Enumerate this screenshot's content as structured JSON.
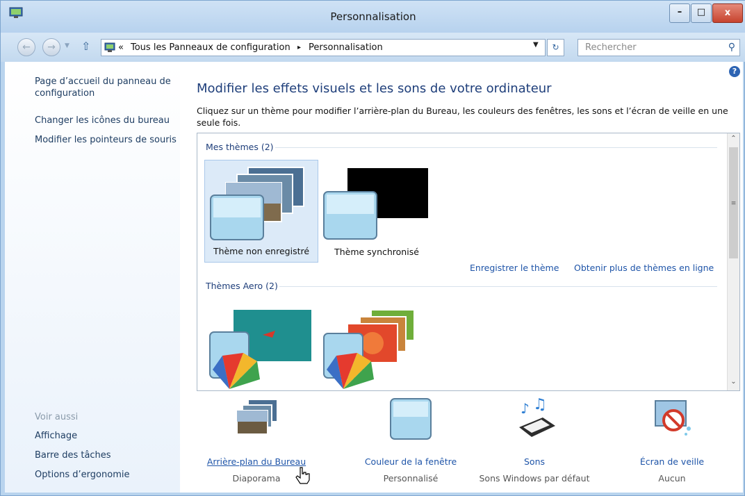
{
  "window": {
    "title": "Personnalisation"
  },
  "titlebar": {
    "minimize": "–",
    "maximize": "□",
    "close": "x"
  },
  "navbar": {
    "breadcrumb_sep": "«",
    "crumb1": "Tous les Panneaux de configuration",
    "crumb_arrow": "▸",
    "crumb2": "Personnalisation",
    "search_placeholder": "Rechercher"
  },
  "sidebar": {
    "home_link": "Page d’accueil du panneau de configuration",
    "links": [
      "Changer les icônes du bureau",
      "Modifier les pointeurs de souris"
    ],
    "see_also": "Voir aussi",
    "see_also_links": [
      "Affichage",
      "Barre des tâches",
      "Options d’ergonomie"
    ]
  },
  "main": {
    "title": "Modifier les effets visuels et les sons de votre ordinateur",
    "description": "Cliquez sur un thème pour modifier l’arrière-plan du Bureau, les couleurs des fenêtres, les sons et l’écran de veille en une seule fois."
  },
  "themes": {
    "my_themes_header": "Mes thèmes (2)",
    "my_themes": [
      {
        "label": "Thème non enregistré",
        "selected": true
      },
      {
        "label": "Thème synchronisé",
        "selected": false
      }
    ],
    "save_theme_link": "Enregistrer le thème",
    "get_more_link": "Obtenir plus de thèmes en ligne",
    "aero_header": "Thèmes Aero (2)"
  },
  "bottom": [
    {
      "link": "Arrière-plan du Bureau",
      "sub": "Diaporama",
      "icon": "desktop-background-icon"
    },
    {
      "link": "Couleur de la fenêtre",
      "sub": "Personnalisé",
      "icon": "window-color-icon"
    },
    {
      "link": "Sons",
      "sub": "Sons Windows par défaut",
      "icon": "sounds-icon"
    },
    {
      "link": "Écran de veille",
      "sub": "Aucun",
      "icon": "screensaver-icon"
    }
  ],
  "colors": {
    "accent_link": "#1e54a8",
    "title_blue": "#1e3e7a",
    "selection": "#dceaf8"
  }
}
